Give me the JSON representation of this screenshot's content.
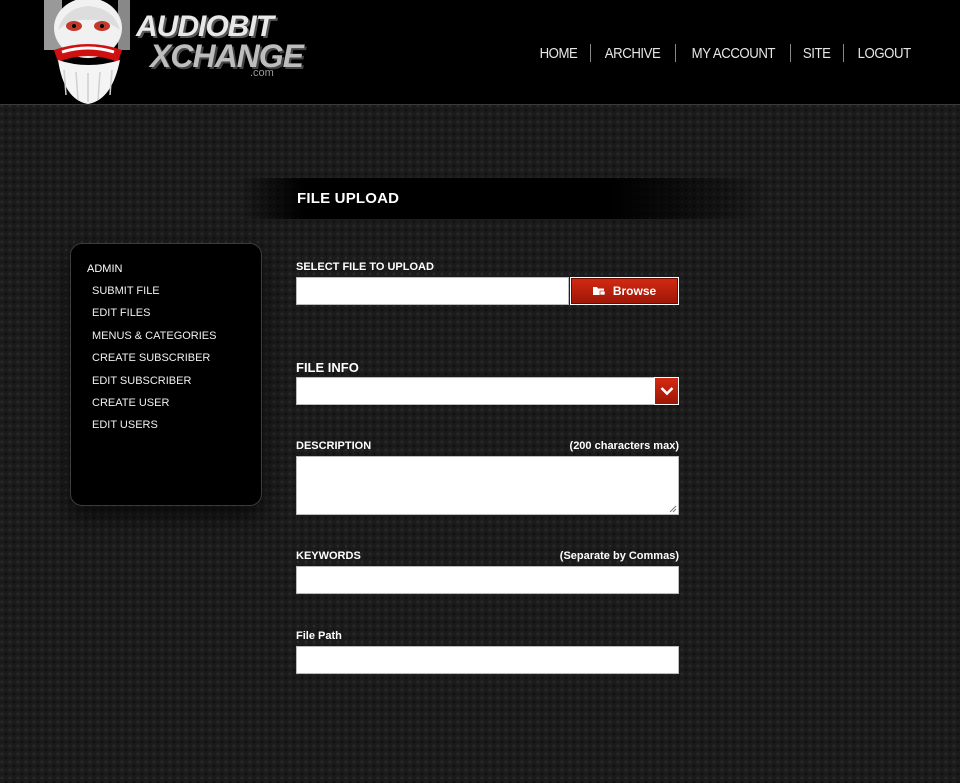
{
  "brand": {
    "line1": "AUDIOBIT",
    "line2": "XCHANGE",
    "line3": ".com"
  },
  "nav": {
    "home": "HOME",
    "archive": "ARCHIVE",
    "account": "MY ACCOUNT",
    "site": "SITE",
    "logout": "LOGOUT"
  },
  "page": {
    "title": "FILE UPLOAD"
  },
  "sidebar": {
    "heading": "ADMIN",
    "items": [
      "SUBMIT FILE",
      "EDIT FILES",
      "MENUS & CATEGORIES",
      "CREATE SUBSCRIBER",
      "EDIT SUBSCRIBER",
      "CREATE USER",
      "EDIT USERS"
    ]
  },
  "form": {
    "select_file_label": "SELECT FILE TO UPLOAD",
    "file_value": "",
    "browse_label": "Browse",
    "file_info_label": "FILE INFO",
    "file_info_value": "",
    "description_label": "DESCRIPTION",
    "description_hint": "(200 characters max)",
    "description_value": "",
    "keywords_label": "KEYWORDS",
    "keywords_hint": "(Separate by Commas)",
    "keywords_value": "",
    "filepath_label": "File Path",
    "filepath_value": ""
  },
  "colors": {
    "accent": "#c41e0a",
    "background": "#1b1b1b",
    "header": "#000000"
  },
  "icons": {
    "browse": "folder-icon",
    "select": "chevron-down-icon",
    "logo": "mascot-icon"
  }
}
